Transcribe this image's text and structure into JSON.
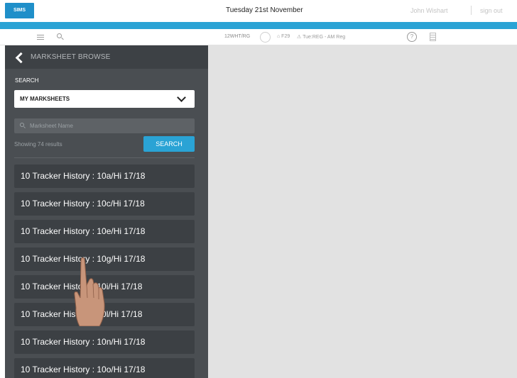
{
  "topbar": {
    "logo_text": "SIMS",
    "date": "Tuesday 21st November",
    "user": "John Wishart",
    "sign_out": "sign out"
  },
  "subbar": {
    "class_code": "12WHT/RG",
    "room": "⌂ F29",
    "register": "⚠ Tue:REG - AM Reg",
    "help_glyph": "?"
  },
  "sidebar": {
    "title": "MARKSHEET BROWSE",
    "search_label": "SEARCH",
    "select_value": "MY MARKSHEETS",
    "search_placeholder": "Marksheet Name",
    "results_text": "Showing 74 results",
    "search_button": "SEARCH",
    "items": [
      "10 Tracker History : 10a/Hi 17/18",
      "10 Tracker History : 10c/Hi 17/18",
      "10 Tracker History : 10e/Hi 17/18",
      "10 Tracker History : 10g/Hi 17/18",
      "10 Tracker History : 10i/Hi 17/18",
      "10 Tracker History : 10l/Hi 17/18",
      "10 Tracker History : 10n/Hi 17/18",
      "10 Tracker History : 10o/Hi 17/18"
    ]
  },
  "colors": {
    "accent": "#2aa3d5",
    "sidebar_bg": "#4a4e52",
    "item_bg": "#3c4044",
    "main_bg": "#e2e2e2"
  }
}
